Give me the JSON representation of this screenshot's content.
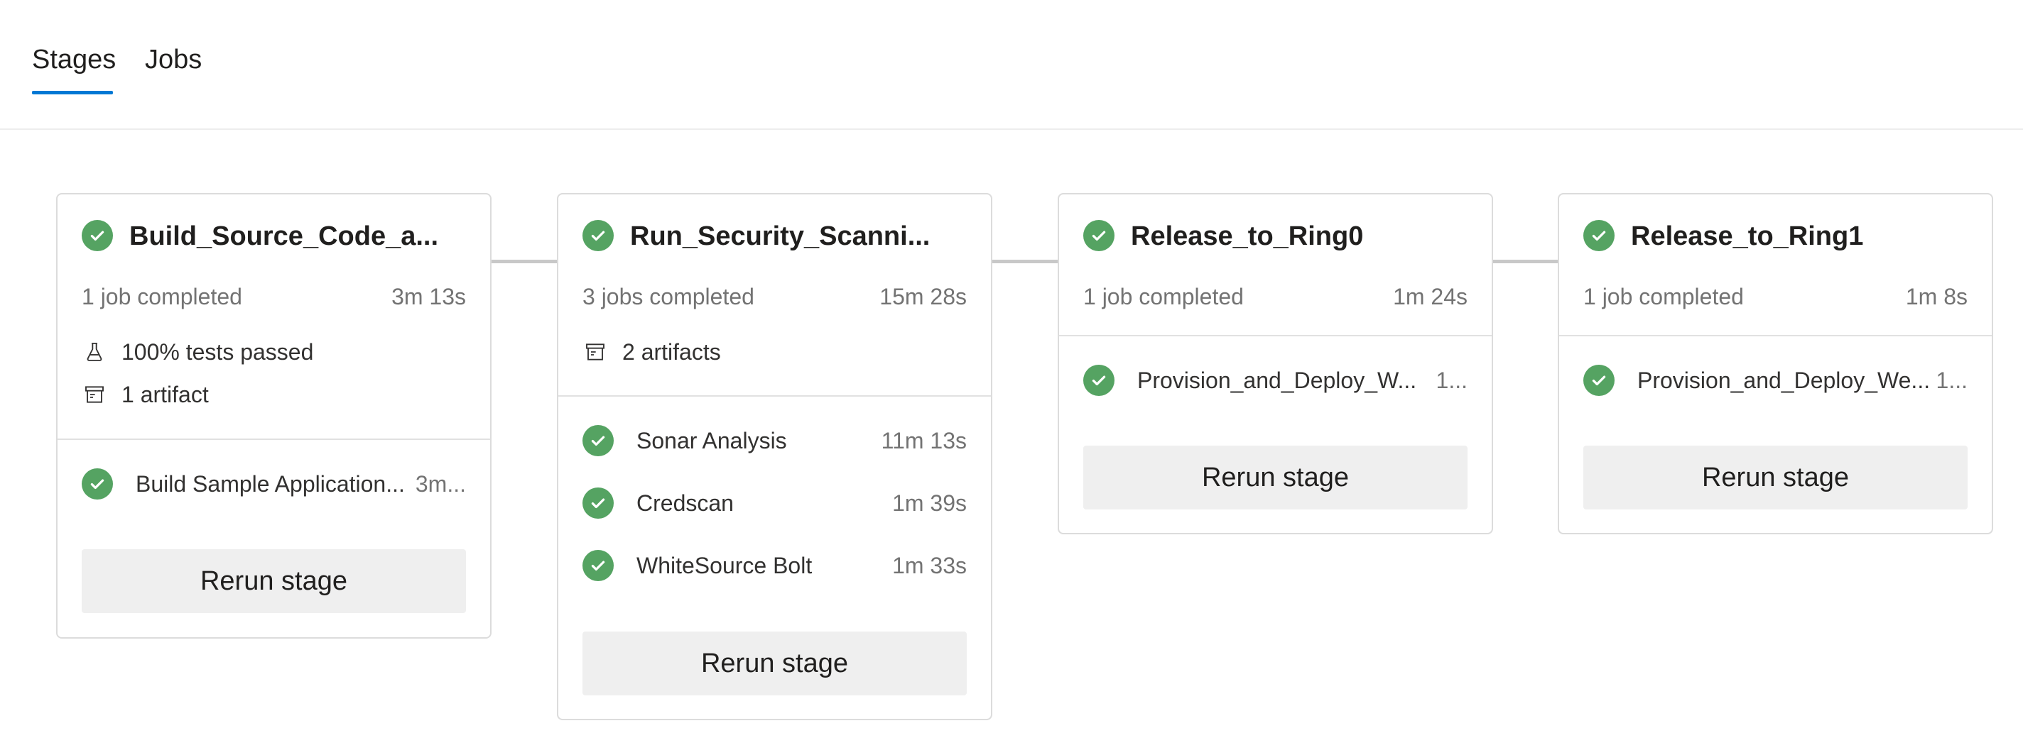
{
  "tabs": {
    "stages": "Stages",
    "jobs": "Jobs",
    "active": "Stages"
  },
  "colors": {
    "accent": "#0078d4",
    "success": "#55a362"
  },
  "stages": [
    {
      "title": "Build_Source_Code_a...",
      "summary": "1 job completed",
      "duration": "3m 13s",
      "tests": "100% tests passed",
      "artifacts": "1 artifact",
      "jobs": [
        {
          "name": "Build Sample Application...",
          "duration": "3m..."
        }
      ],
      "rerun": "Rerun stage"
    },
    {
      "title": "Run_Security_Scanni...",
      "summary": "3 jobs completed",
      "duration": "15m 28s",
      "artifacts": "2 artifacts",
      "jobs": [
        {
          "name": "Sonar Analysis",
          "duration": "11m 13s"
        },
        {
          "name": "Credscan",
          "duration": "1m 39s"
        },
        {
          "name": "WhiteSource Bolt",
          "duration": "1m 33s"
        }
      ],
      "rerun": "Rerun stage"
    },
    {
      "title": "Release_to_Ring0",
      "summary": "1 job completed",
      "duration": "1m 24s",
      "jobs": [
        {
          "name": "Provision_and_Deploy_W...",
          "duration": "1..."
        }
      ],
      "rerun": "Rerun stage"
    },
    {
      "title": "Release_to_Ring1",
      "summary": "1 job completed",
      "duration": "1m 8s",
      "jobs": [
        {
          "name": "Provision_and_Deploy_We...",
          "duration": "1..."
        }
      ],
      "rerun": "Rerun stage"
    }
  ]
}
